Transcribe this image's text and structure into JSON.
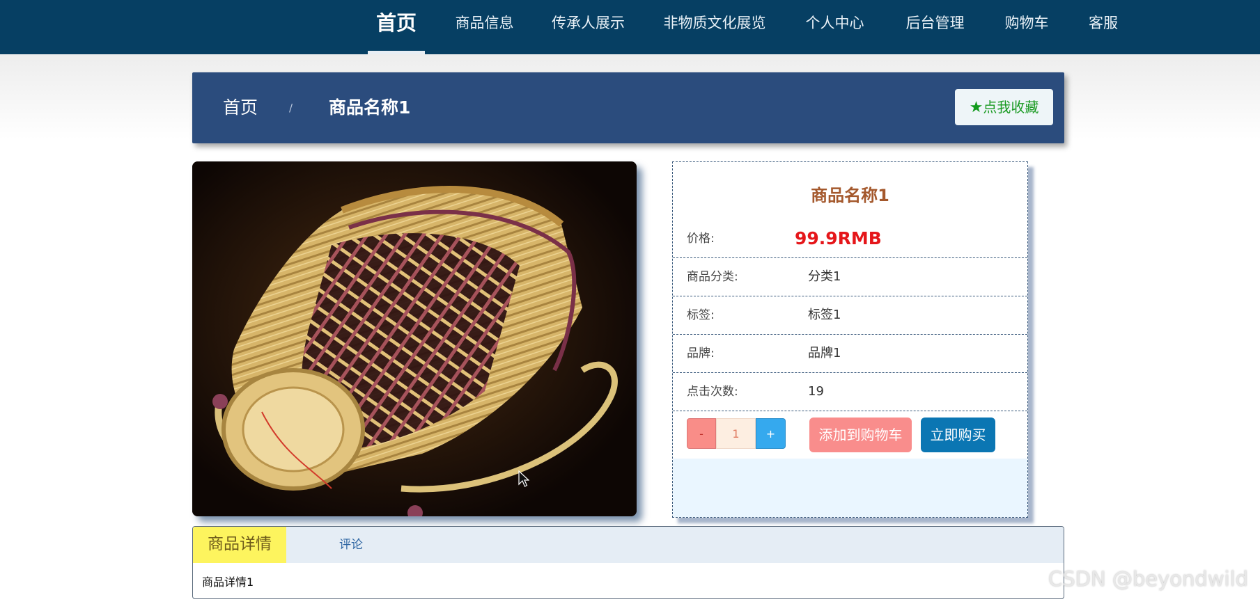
{
  "nav": {
    "items": [
      {
        "label": "首页",
        "active": true
      },
      {
        "label": "商品信息"
      },
      {
        "label": "传承人展示"
      },
      {
        "label": "非物质文化展览"
      },
      {
        "label": "个人中心"
      },
      {
        "label": "后台管理"
      },
      {
        "label": "购物车"
      },
      {
        "label": "客服"
      }
    ]
  },
  "breadcrumb": {
    "home": "首页",
    "separator": "/",
    "current": "商品名称1"
  },
  "favorite": {
    "star_icon": "star-icon",
    "label": "点我收藏"
  },
  "product": {
    "image_icon": "woven-bamboo-basket-photo",
    "title": "商品名称1",
    "price": {
      "label": "价格:",
      "value": "99.9RMB"
    },
    "rows": [
      {
        "label": "商品分类:",
        "value": "分类1"
      },
      {
        "label": "标签:",
        "value": "标签1"
      },
      {
        "label": "品牌:",
        "value": "品牌1"
      },
      {
        "label": "点击次数:",
        "value": "19"
      }
    ],
    "quantity": {
      "minus": "-",
      "value": "1",
      "plus": "+"
    },
    "add_to_cart": "添加到购物车",
    "buy_now": "立即购买"
  },
  "tabs": {
    "items": [
      {
        "label": "商品详情",
        "active": true
      },
      {
        "label": "评论"
      }
    ],
    "content": "商品详情1"
  },
  "watermark": "CSDN @beyondwild",
  "colors": {
    "nav_bg": "#063f63",
    "breadcrumb_bg": "#2b4c7d",
    "price": "#e5161a",
    "title": "#a4582c",
    "add_cart": "#f98d8c",
    "buy_now": "#0b76b3",
    "active_tab": "#fdf45e"
  }
}
